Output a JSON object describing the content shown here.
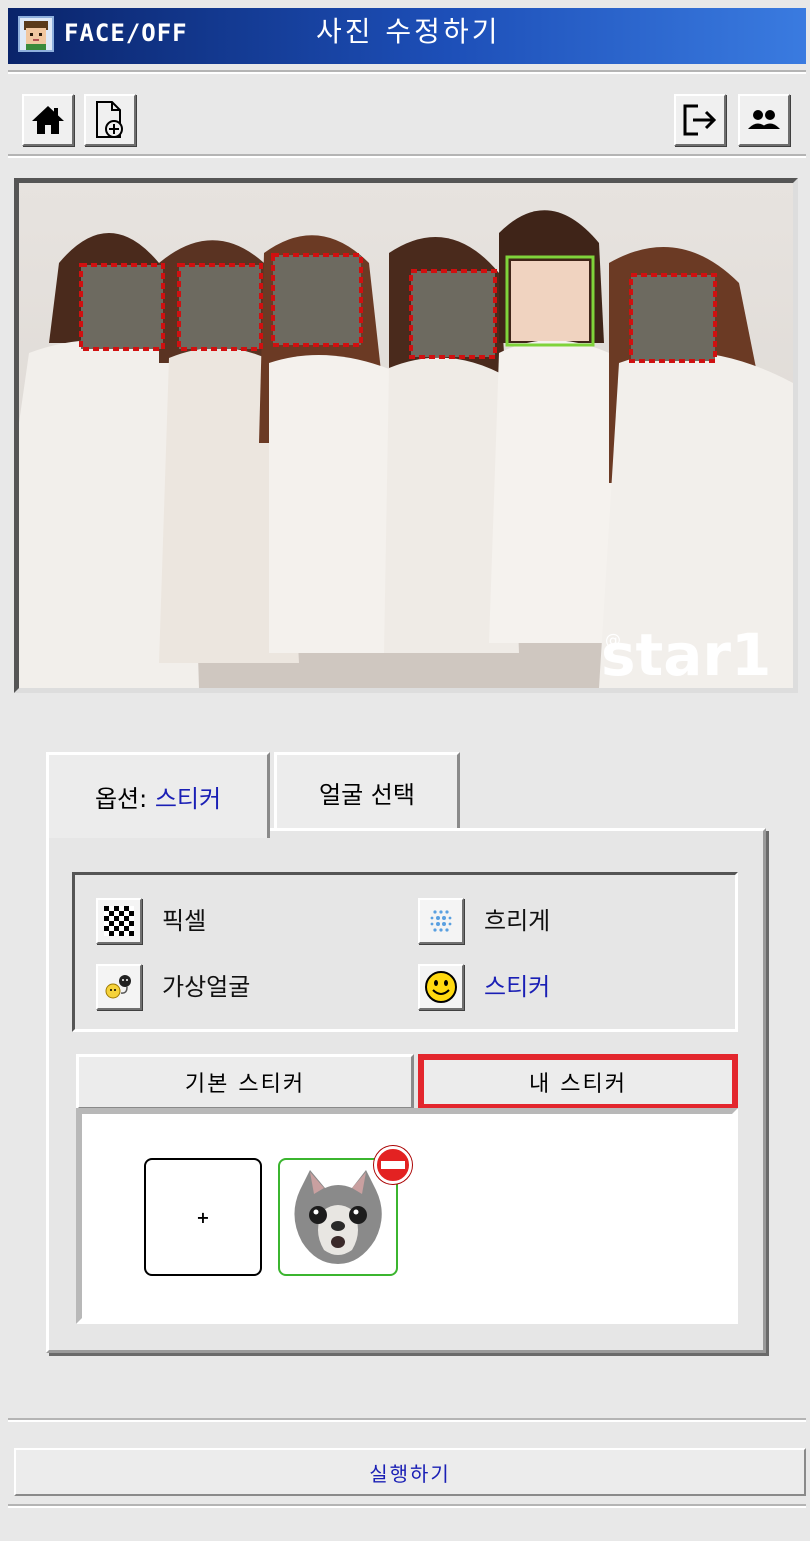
{
  "app": {
    "name": "FACE/OFF",
    "window_title": "사진 수정하기"
  },
  "toolbar": {
    "left_icons": [
      "home-icon",
      "new-file-icon"
    ],
    "right_icons": [
      "logout-icon",
      "users-icon"
    ]
  },
  "photo": {
    "watermark_prefix": "@",
    "watermark": "star1",
    "faces_total": 6,
    "faces_marked_red": 5,
    "faces_selected_green": 1
  },
  "tabs": {
    "options_prefix": "옵션: ",
    "options_value": "스티커",
    "face_select": "얼굴 선택"
  },
  "options": [
    {
      "label": "픽셀",
      "icon": "pixel-icon"
    },
    {
      "label": "흐리게",
      "icon": "blur-icon"
    },
    {
      "label": "가상얼굴",
      "icon": "virtual-face-icon"
    },
    {
      "label": "스티커",
      "icon": "smiley-icon"
    }
  ],
  "sticker_tabs": {
    "basic": "기본 스티커",
    "mine": "내 스티커"
  },
  "stickers": {
    "add_label": "+"
  },
  "actions": {
    "run": "실행하기"
  },
  "colors": {
    "accent_text": "#1a1fb5",
    "highlight": "#e3262d",
    "face_box": "#d01010",
    "selected_box": "#7fd33a"
  }
}
